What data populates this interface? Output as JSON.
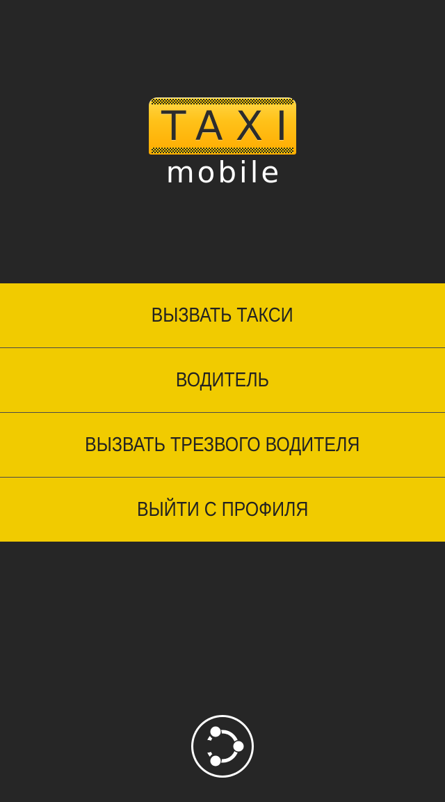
{
  "logo": {
    "top_word": "TAXI",
    "bottom_word": "mobile",
    "badge_color": "#ffc21a"
  },
  "menu": {
    "items": [
      {
        "label": "ВЫЗВАТЬ ТАКСИ"
      },
      {
        "label": "ВОДИТЕЛЬ"
      },
      {
        "label": "ВЫЗВАТЬ ТРЕЗВОГО ВОДИТЕЛЯ"
      },
      {
        "label": "ВЫЙТИ С ПРОФИЛЯ"
      }
    ],
    "background_color": "#f1cb00"
  },
  "footer": {
    "icon": "ubuntu-circle-of-friends-icon"
  },
  "colors": {
    "background": "#262626",
    "accent": "#f1cb00",
    "text_dark": "#222222",
    "text_light": "#ffffff"
  }
}
